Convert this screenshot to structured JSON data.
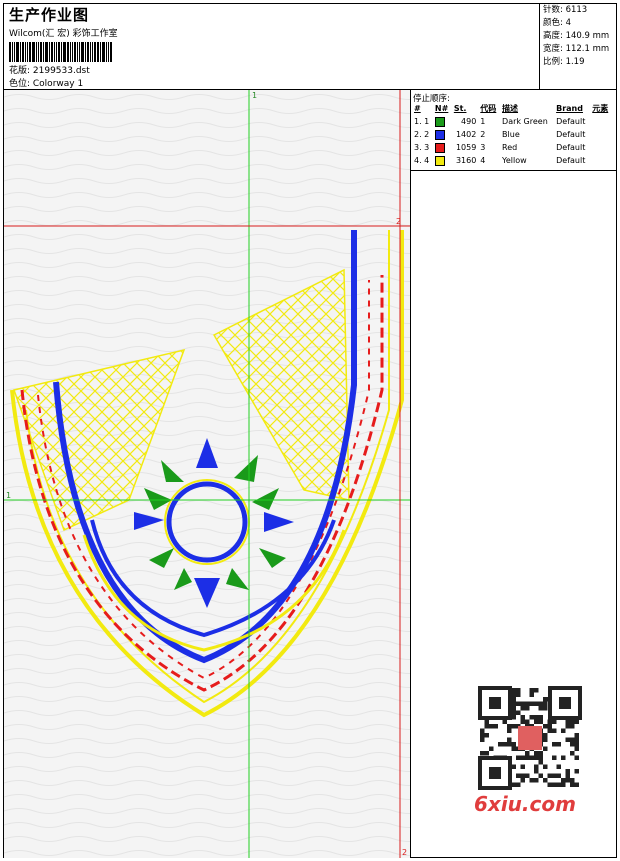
{
  "header": {
    "title": "生产作业图",
    "studio": "Wilcom(汇 宏) 彩饰工作室",
    "design_name": "花版: 2199533.dst",
    "colorway": "色位: Colorway 1"
  },
  "stats": {
    "stitches": "针数: 6113",
    "colors": "颜色: 4",
    "height": "高度: 140.9 mm",
    "width": "宽度: 112.1 mm",
    "scale": "比例: 1.19"
  },
  "stop_sequence": {
    "title": "停止顺序:",
    "headers": [
      "#",
      "N#",
      "St.",
      "代码",
      "描述",
      "Brand",
      "元素"
    ],
    "rows": [
      {
        "idx": "1. 1",
        "color": "#1a9a1a",
        "stitches": "490",
        "code": "1",
        "desc": "Dark Green",
        "brand": "Default"
      },
      {
        "idx": "2. 2",
        "color": "#1c2ee6",
        "stitches": "1402",
        "code": "2",
        "desc": "Blue",
        "brand": "Default"
      },
      {
        "idx": "3. 3",
        "color": "#e61c1c",
        "stitches": "1059",
        "code": "3",
        "desc": "Red",
        "brand": "Default"
      },
      {
        "idx": "4. 4",
        "color": "#f2ea10",
        "stitches": "3160",
        "code": "4",
        "desc": "Yellow",
        "brand": "Default"
      }
    ]
  },
  "design_markers": {
    "center_v": "1",
    "center_h": "1",
    "limit_top": "2",
    "limit_bottom": "2"
  },
  "watermark": "6xiu.com",
  "colors": {
    "green": "#1a9a1a",
    "blue": "#1c2ee6",
    "red": "#e61c1c",
    "yellow": "#f2ea10"
  }
}
